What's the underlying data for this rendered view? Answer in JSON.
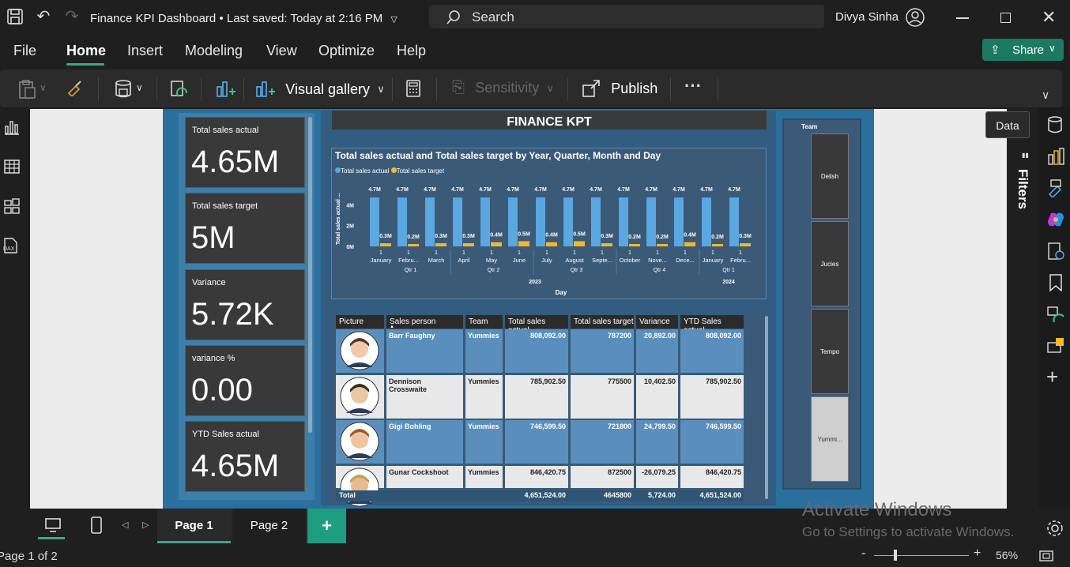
{
  "window": {
    "title": "Finance KPI Dashboard",
    "saved_status": "Last saved: Today at 2:16 PM",
    "search_placeholder": "Search",
    "user_name": "Divya Sinha"
  },
  "menu": {
    "items": [
      "File",
      "Home",
      "Insert",
      "Modeling",
      "View",
      "Optimize",
      "Help"
    ],
    "active": "Home",
    "share_label": "Share"
  },
  "ribbon": {
    "visual_gallery": "Visual gallery",
    "sensitivity": "Sensitivity",
    "publish": "Publish",
    "more": "···"
  },
  "right_pane": {
    "filters_label": "Filters",
    "data_tooltip": "Data"
  },
  "report": {
    "banner": "FINANCE KPT",
    "kpis": [
      {
        "title": "Total sales actual",
        "value": "4.65M"
      },
      {
        "title": "Total sales target",
        "value": "5M"
      },
      {
        "title": "Variance",
        "value": "5.72K"
      },
      {
        "title": "variance %",
        "value": "0.00"
      },
      {
        "title": "YTD Sales actual",
        "value": "4.65M"
      }
    ],
    "team_slicer": {
      "title": "Team",
      "items": [
        "Delish",
        "Jucies",
        "Tempo",
        "Yummi..."
      ]
    },
    "table": {
      "headers": [
        "Picture",
        "Sales person",
        "Team",
        "Total sales actual",
        "Total sales target",
        "Variance",
        "YTD Sales actual"
      ],
      "rows": [
        {
          "person": "Barr Faughny",
          "team": "Yummies",
          "actual": "808,092.00",
          "target": "787200",
          "variance": "20,892.00",
          "ytd": "808,092.00"
        },
        {
          "person": "Dennison Crosswaite",
          "team": "Yummies",
          "actual": "785,902.50",
          "target": "775500",
          "variance": "10,402.50",
          "ytd": "785,902.50"
        },
        {
          "person": "Gigi Bohling",
          "team": "Yummies",
          "actual": "746,599.50",
          "target": "721800",
          "variance": "24,799.50",
          "ytd": "746,599.50"
        },
        {
          "person": "Gunar Cockshoot",
          "team": "Yummies",
          "actual": "846,420.75",
          "target": "872500",
          "variance": "-26,079.25",
          "ytd": "846,420.75"
        }
      ],
      "total": {
        "label": "Total",
        "actual": "4,651,524.00",
        "target": "4645800",
        "variance": "5,724.00",
        "ytd": "4,651,524.00"
      }
    }
  },
  "chart_data": {
    "type": "bar",
    "title": "Total sales actual and Total sales target by Year, Quarter, Month and Day",
    "ylabel": "Total sales actual ...",
    "xlabel": "Day",
    "ylim": [
      0,
      5
    ],
    "y_ticks": [
      "0M",
      "2M",
      "4M"
    ],
    "legend_position": "top-left",
    "categories": [
      "January",
      "Febru...",
      "March",
      "April",
      "May",
      "June",
      "July",
      "August",
      "Septe...",
      "October",
      "Nove...",
      "Dece...",
      "January",
      "Febru..."
    ],
    "day_labels": [
      "1",
      "1",
      "1",
      "1",
      "1",
      "1",
      "1",
      "1",
      "1",
      "1",
      "1",
      "1",
      "1",
      "1"
    ],
    "quarters": [
      {
        "label": "Qtr 1",
        "span": 3
      },
      {
        "label": "Qtr 2",
        "span": 3
      },
      {
        "label": "Qtr 3",
        "span": 3
      },
      {
        "label": "Qtr 4",
        "span": 3
      },
      {
        "label": "Qtr 1",
        "span": 2
      }
    ],
    "years": [
      {
        "label": "2023",
        "span": 12
      },
      {
        "label": "2024",
        "span": 2
      }
    ],
    "series": [
      {
        "name": "Total sales actual",
        "color": "#5aa7e2",
        "values": [
          4.7,
          4.7,
          4.7,
          4.7,
          4.7,
          4.7,
          4.7,
          4.7,
          4.7,
          4.7,
          4.7,
          4.7,
          4.7,
          4.7
        ],
        "labels": [
          "4.7M",
          "4.7M",
          "4.7M",
          "4.7M",
          "4.7M",
          "4.7M",
          "4.7M",
          "4.7M",
          "4.7M",
          "4.7M",
          "4.7M",
          "4.7M",
          "4.7M",
          "4.7M"
        ]
      },
      {
        "name": "Total sales target",
        "color": "#f5b82a",
        "values": [
          0.3,
          0.2,
          0.3,
          0.3,
          0.4,
          0.5,
          0.4,
          0.5,
          0.3,
          0.2,
          0.2,
          0.4,
          0.2,
          0.3
        ],
        "labels": [
          "0.3M",
          "0.2M",
          "0.3M",
          "0.3M",
          "0.4M",
          "0.5M",
          "0.4M",
          "0.5M",
          "0.3M",
          "0.2M",
          "0.2M",
          "0.4M",
          "0.2M",
          "0.3M"
        ]
      }
    ]
  },
  "pages": {
    "tabs": [
      "Page 1",
      "Page 2"
    ],
    "active": "Page 1",
    "add_label": "+",
    "indicator": "Page 1 of 2"
  },
  "watermark": {
    "line1": "Activate Windows",
    "line2": "Go to Settings to activate Windows."
  },
  "zoom": {
    "level": "56%",
    "minus": "-",
    "plus": "+"
  }
}
